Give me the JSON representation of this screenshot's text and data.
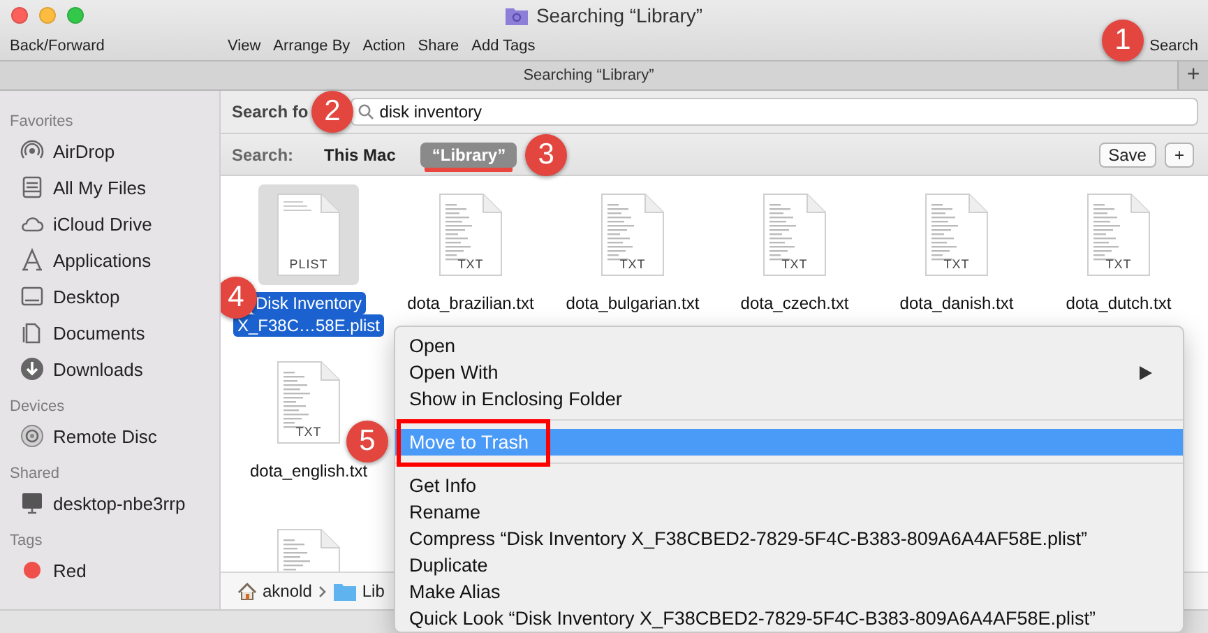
{
  "window": {
    "title": "Searching “Library”"
  },
  "toolbar": {
    "back_forward": "Back/Forward",
    "items": [
      "View",
      "Arrange By",
      "Action",
      "Share",
      "Add Tags"
    ],
    "search": "Search",
    "callout": "1"
  },
  "tab_bar": {
    "title": "Searching “Library”",
    "add": "+"
  },
  "sidebar": {
    "sections": [
      {
        "title": "Favorites",
        "items": [
          {
            "label": "AirDrop",
            "kind": "airdrop"
          },
          {
            "label": "All My Files",
            "kind": "files"
          },
          {
            "label": "iCloud Drive",
            "kind": "cloud"
          },
          {
            "label": "Applications",
            "kind": "apps"
          },
          {
            "label": "Desktop",
            "kind": "desktop"
          },
          {
            "label": "Documents",
            "kind": "documents"
          },
          {
            "label": "Downloads",
            "kind": "downloads"
          }
        ]
      },
      {
        "title": "Devices",
        "items": [
          {
            "label": "Remote Disc",
            "kind": "disc"
          }
        ]
      },
      {
        "title": "Shared",
        "items": [
          {
            "label": "desktop-nbe3rrp",
            "kind": "computer"
          }
        ]
      },
      {
        "title": "Tags",
        "items": [
          {
            "label": "Red",
            "kind": "tag",
            "color": "#f0504a"
          }
        ]
      }
    ]
  },
  "search_bar": {
    "label": "Search fo",
    "query": "disk inventory",
    "callout": "2"
  },
  "scope_bar": {
    "label": "Search:",
    "scopes": [
      {
        "label": "This Mac",
        "selected": false,
        "underlined": false
      },
      {
        "label": "“Library”",
        "selected": true,
        "underlined": true
      }
    ],
    "callout": "3",
    "save": "Save",
    "add": "+"
  },
  "file_rows": [
    [
      {
        "name": "Disk Inventory X_F38C…58E.plist",
        "badge": "PLIST",
        "kind": "plist",
        "selected": true,
        "callout": "4"
      },
      {
        "name": "dota_brazilian.txt",
        "badge": "TXT",
        "kind": "txt",
        "selected": false
      },
      {
        "name": "dota_bulgarian.txt",
        "badge": "TXT",
        "kind": "txt",
        "selected": false
      },
      {
        "name": "dota_czech.txt",
        "badge": "TXT",
        "kind": "txt",
        "selected": false
      },
      {
        "name": "dota_danish.txt",
        "badge": "TXT",
        "kind": "txt",
        "selected": false
      },
      {
        "name": "dota_dutch.txt",
        "badge": "TXT",
        "kind": "txt",
        "selected": false
      }
    ],
    [
      {
        "name": "dota_english.txt",
        "badge": "TXT",
        "kind": "txt",
        "selected": false
      }
    ],
    [
      {
        "kind": "txt",
        "selected": false
      }
    ]
  ],
  "path_bar": [
    {
      "label": "aknold",
      "kind": "home"
    },
    {
      "label": "Lib",
      "kind": "folder"
    }
  ],
  "context_menu": {
    "items": [
      {
        "kind": "item",
        "label": "Open",
        "selected": false
      },
      {
        "kind": "submenu",
        "label": "Open With",
        "selected": false
      },
      {
        "kind": "item",
        "label": "Show in Enclosing Folder",
        "selected": false
      },
      {
        "kind": "separator"
      },
      {
        "kind": "item",
        "label": "Move to Trash",
        "selected": true,
        "boxed": true,
        "callout": "5"
      },
      {
        "kind": "separator"
      },
      {
        "kind": "item",
        "label": "Get Info",
        "selected": false
      },
      {
        "kind": "item",
        "label": "Rename",
        "selected": false
      },
      {
        "kind": "item",
        "label": "Compress “Disk Inventory X_F38CBED2-7829-5F4C-B383-809A6A4AF58E.plist”",
        "selected": false
      },
      {
        "kind": "item",
        "label": "Duplicate",
        "selected": false
      },
      {
        "kind": "item",
        "label": "Make Alias",
        "selected": false
      },
      {
        "kind": "item",
        "label": "Quick Look “Disk Inventory X_F38CBED2-7829-5F4C-B383-809A6A4AF58E.plist”",
        "selected": false
      }
    ]
  }
}
